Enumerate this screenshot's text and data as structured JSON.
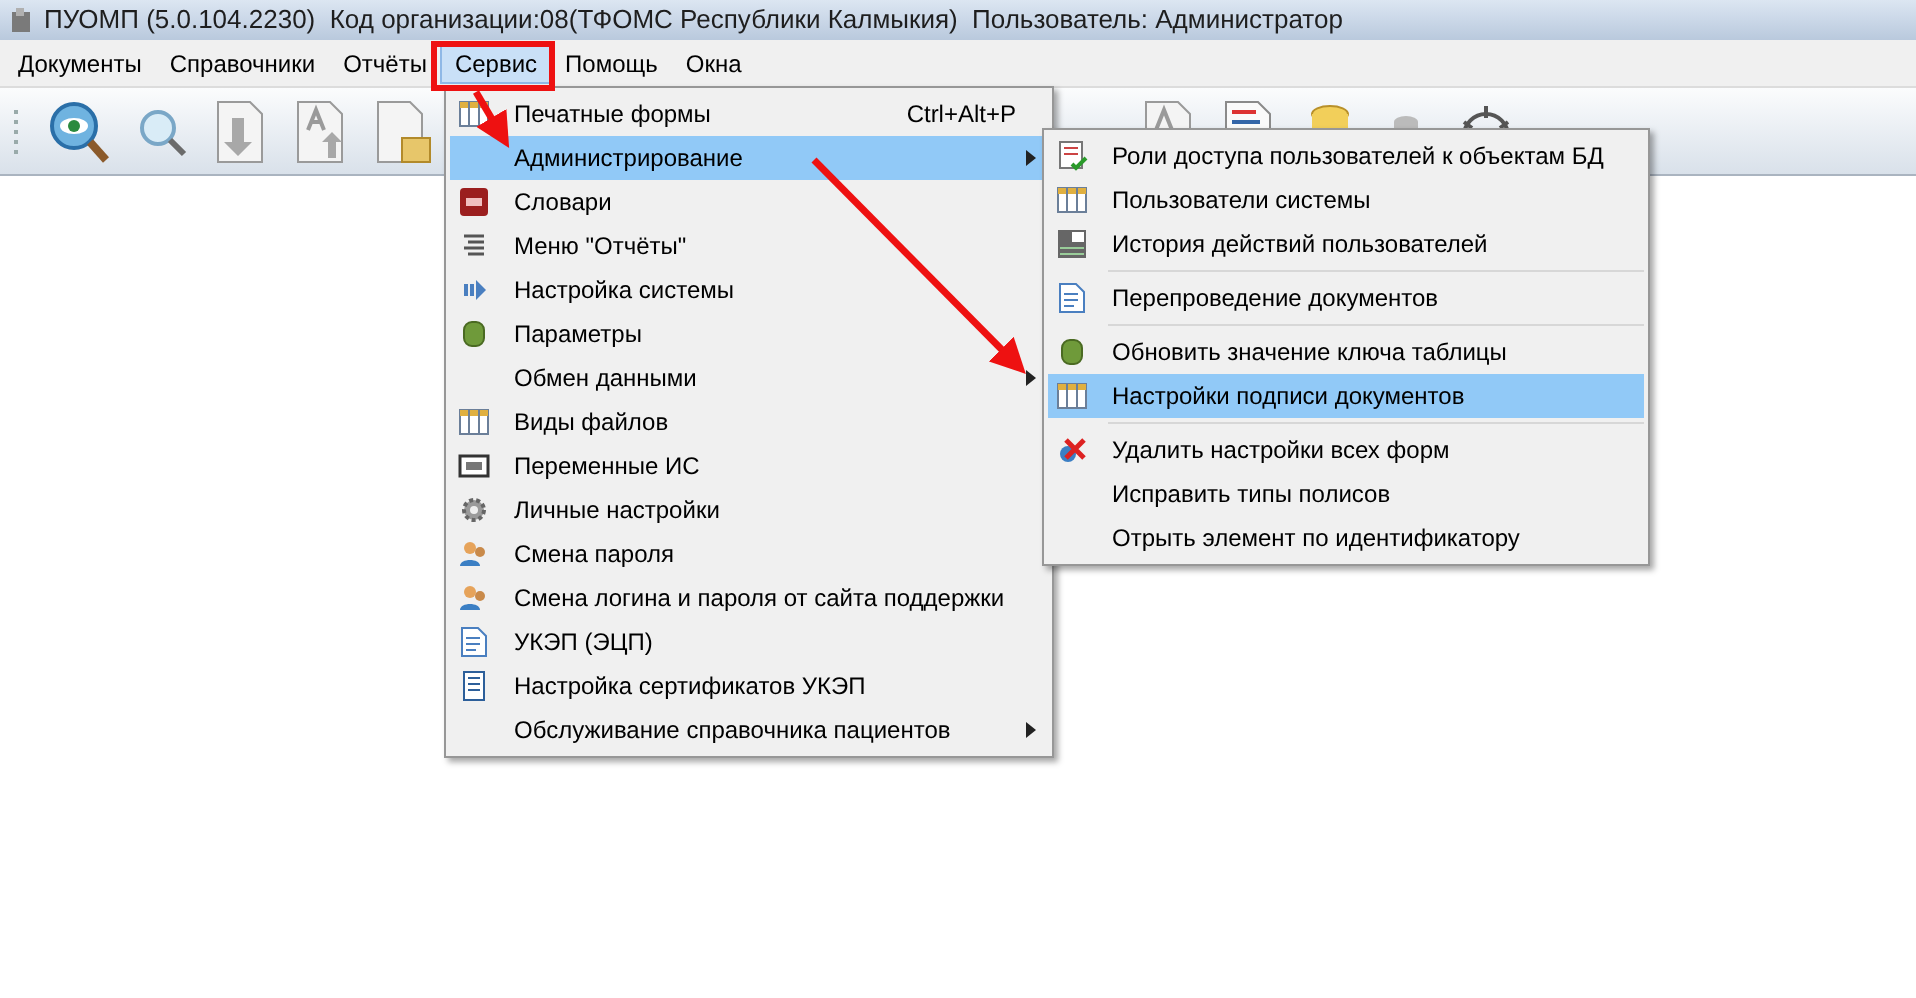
{
  "window": {
    "title": "ПУОМП (5.0.104.2230)  Код организации:08(ТФОМС Республики Калмыкия)  Пользователь: Администратор"
  },
  "menu_bar": [
    {
      "label": "Документы",
      "selected": false
    },
    {
      "label": "Справочники",
      "selected": false
    },
    {
      "label": "Отчёты",
      "selected": false
    },
    {
      "label": "Сервис",
      "selected": true
    },
    {
      "label": "Помощь",
      "selected": false
    },
    {
      "label": "Окна",
      "selected": false
    }
  ],
  "service_menu": [
    {
      "label": "Печатные формы",
      "shortcut": "Ctrl+Alt+P",
      "kind": "grid",
      "selected": false,
      "submenu": false
    },
    {
      "label": "Администрирование",
      "selected": true,
      "submenu": true
    },
    {
      "label": "Словари",
      "kind": "dictionary",
      "selected": false,
      "submenu": false
    },
    {
      "label": "Меню \"Отчёты\"",
      "kind": "lines",
      "selected": false,
      "submenu": false
    },
    {
      "label": "Настройка системы",
      "kind": "play",
      "selected": false,
      "submenu": false
    },
    {
      "label": "Параметры",
      "kind": "database",
      "selected": false,
      "submenu": false
    },
    {
      "label": "Обмен данными",
      "selected": false,
      "submenu": true
    },
    {
      "label": "Виды файлов",
      "kind": "grid",
      "selected": false,
      "submenu": false
    },
    {
      "label": "Переменные ИС",
      "kind": "variable",
      "selected": false,
      "submenu": false
    },
    {
      "label": "Личные настройки",
      "kind": "gear",
      "selected": false,
      "submenu": false
    },
    {
      "label": "Смена пароля",
      "kind": "users",
      "selected": false,
      "submenu": false
    },
    {
      "label": "Смена логина и пароля от сайта поддержки",
      "kind": "users",
      "selected": false,
      "submenu": false
    },
    {
      "label": "УКЭП (ЭЦП)",
      "kind": "document",
      "selected": false,
      "submenu": false
    },
    {
      "label": "Настройка сертификатов УКЭП",
      "kind": "list",
      "selected": false,
      "submenu": false
    },
    {
      "label": "Обслуживание справочника пациентов",
      "selected": false,
      "submenu": true
    }
  ],
  "admin_submenu": [
    {
      "label": "Роли доступа пользователей к объектам БД",
      "kind": "checklist",
      "selected": false,
      "separator_after": false
    },
    {
      "label": "Пользователи системы",
      "kind": "grid",
      "selected": false,
      "separator_after": false
    },
    {
      "label": "История действий пользователей",
      "kind": "table",
      "selected": false,
      "separator_after": true
    },
    {
      "label": "Перепроведение документов",
      "kind": "document",
      "selected": false,
      "separator_after": true
    },
    {
      "label": "Обновить значение ключа таблицы",
      "kind": "database",
      "selected": false,
      "separator_after": false
    },
    {
      "label": "Настройки подписи документов",
      "kind": "grid",
      "selected": true,
      "separator_after": true
    },
    {
      "label": "Удалить настройки всех форм",
      "kind": "delete",
      "selected": false,
      "separator_after": false
    },
    {
      "label": "Исправить типы полисов",
      "selected": false,
      "separator_after": false
    },
    {
      "label": "Отрыть элемент по идентификатору",
      "selected": false,
      "separator_after": false
    }
  ]
}
